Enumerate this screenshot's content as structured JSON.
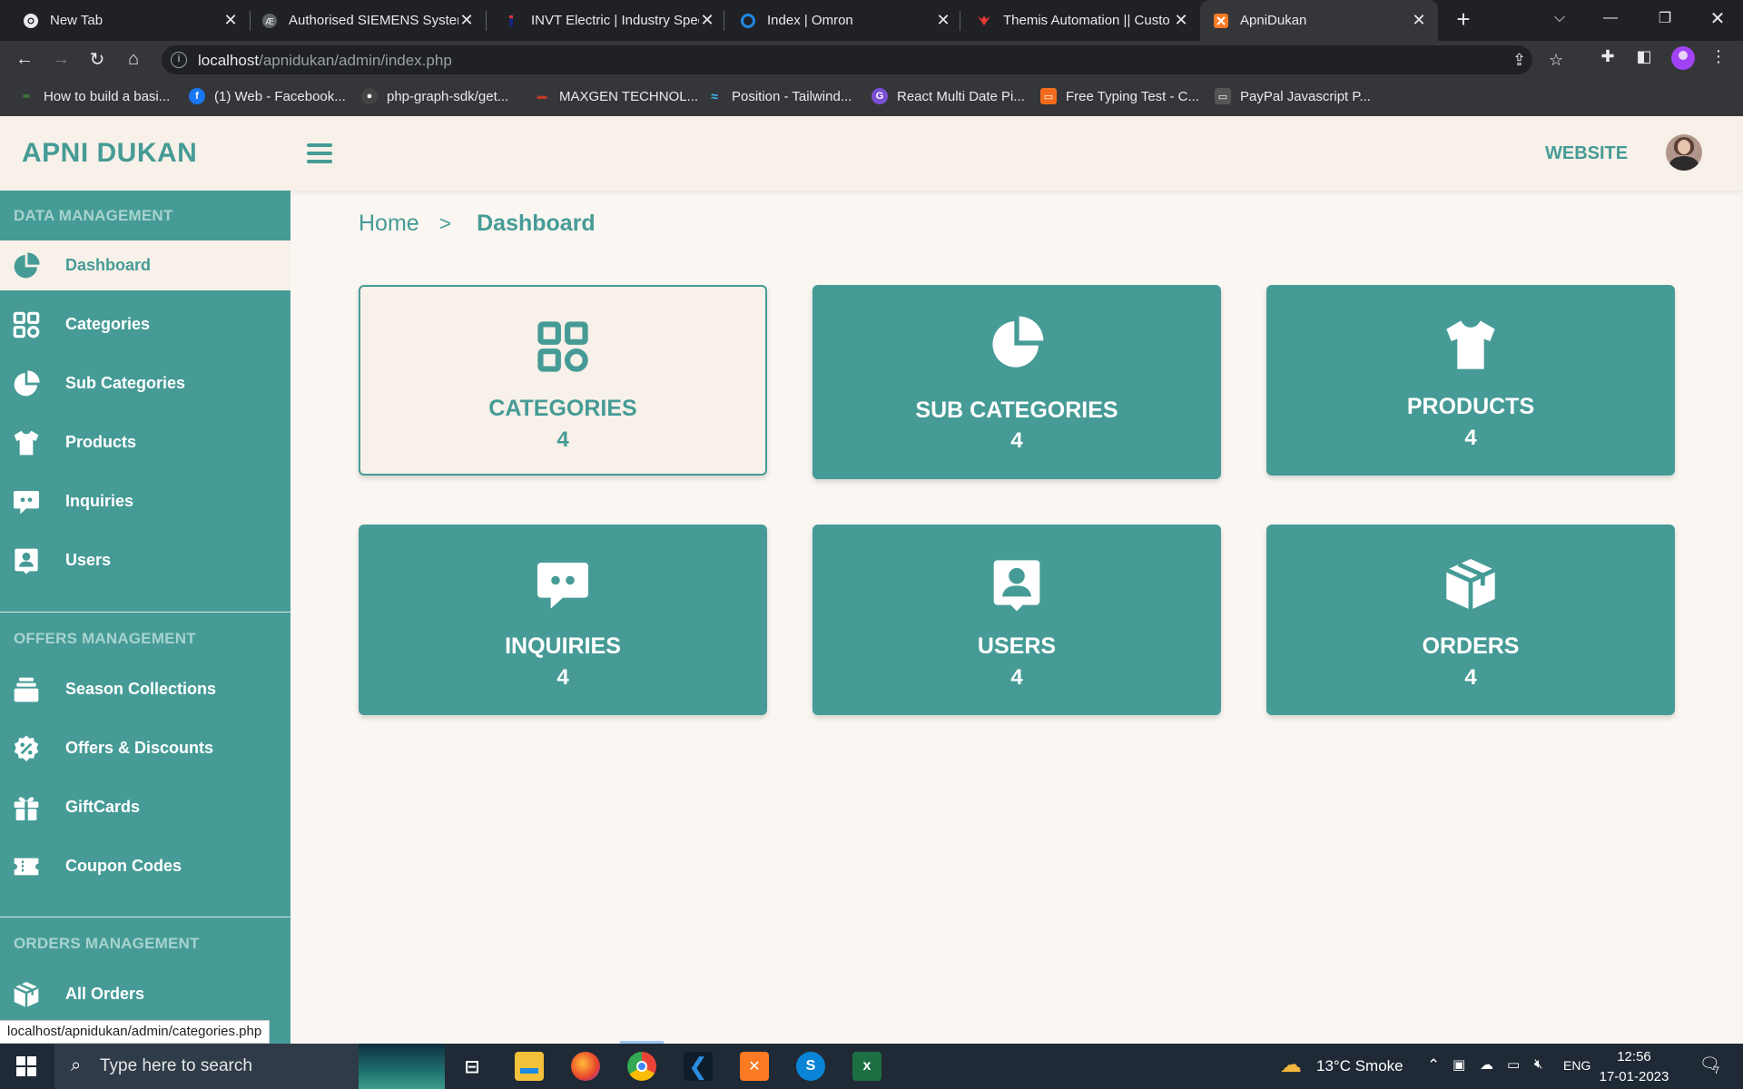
{
  "browser": {
    "tabs": [
      {
        "title": "New Tab",
        "favicon": "chrome-icon",
        "active": false
      },
      {
        "title": "Authorised SIEMENS Systen",
        "favicon": "siemens-icon",
        "active": false
      },
      {
        "title": "INVT Electric | Industry Spec",
        "favicon": "invt-icon",
        "active": false
      },
      {
        "title": "Index | Omron",
        "favicon": "omron-icon",
        "active": false
      },
      {
        "title": "Themis Automation || Custo",
        "favicon": "themis-icon",
        "active": false
      },
      {
        "title": "ApniDukan",
        "favicon": "xampp-icon",
        "active": true
      }
    ],
    "url_host": "localhost",
    "url_path": "/apnidukan/admin/index.php",
    "bookmarks": [
      {
        "label": "How to build a basi...",
        "icon": "bookmark-green-icon",
        "color": "#3c9c3c"
      },
      {
        "label": "(1) Web - Facebook...",
        "icon": "facebook-icon",
        "color": "#1877f2"
      },
      {
        "label": "php-graph-sdk/get...",
        "icon": "github-icon",
        "color": "#444444"
      },
      {
        "label": "MAXGEN TECHNOL...",
        "icon": "maxgen-icon",
        "color": "#c0392b"
      },
      {
        "label": "Position - Tailwind...",
        "icon": "tailwind-icon",
        "color": "#38bdf8"
      },
      {
        "label": "React Multi Date Pi...",
        "icon": "react-date-icon",
        "color": "#7b4fd3"
      },
      {
        "label": "Free Typing Test - C...",
        "icon": "typing-icon",
        "color": "#f26b1d"
      },
      {
        "label": "PayPal Javascript P...",
        "icon": "paypal-icon",
        "color": "#555555"
      }
    ],
    "status_url": "localhost/apnidukan/admin/categories.php"
  },
  "header": {
    "brand": "APNI DUKAN",
    "website_link": "WEBSITE"
  },
  "sidebar": {
    "sections": [
      {
        "title": "DATA MANAGEMENT"
      },
      {
        "title": "OFFERS MANAGEMENT"
      },
      {
        "title": "ORDERS MANAGEMENT"
      }
    ],
    "items": [
      {
        "label": "Dashboard",
        "icon": "pie-chart-icon",
        "active": true
      },
      {
        "label": "Categories",
        "icon": "grid-icon"
      },
      {
        "label": "Sub Categories",
        "icon": "pie-chart-icon"
      },
      {
        "label": "Products",
        "icon": "tshirt-icon"
      },
      {
        "label": "Inquiries",
        "icon": "chat-icon"
      },
      {
        "label": "Users",
        "icon": "user-badge-icon"
      },
      {
        "label": "Season Collections",
        "icon": "stack-icon"
      },
      {
        "label": "Offers & Discounts",
        "icon": "discount-icon"
      },
      {
        "label": "GiftCards",
        "icon": "gift-icon"
      },
      {
        "label": "Coupon Codes",
        "icon": "ticket-icon"
      },
      {
        "label": "All Orders",
        "icon": "box-icon"
      }
    ]
  },
  "breadcrumb": {
    "home": "Home",
    "separator": ">",
    "current": "Dashboard"
  },
  "cards": [
    {
      "title": "CATEGORIES",
      "count": "4",
      "icon": "grid-icon"
    },
    {
      "title": "SUB CATEGORIES",
      "count": "4",
      "icon": "pie-chart-icon"
    },
    {
      "title": "PRODUCTS",
      "count": "4",
      "icon": "tshirt-icon"
    },
    {
      "title": "INQUIRIES",
      "count": "4",
      "icon": "chat-icon"
    },
    {
      "title": "USERS",
      "count": "4",
      "icon": "user-badge-icon"
    },
    {
      "title": "ORDERS",
      "count": "4",
      "icon": "box-icon"
    }
  ],
  "taskbar": {
    "search_placeholder": "Type here to search",
    "weather": "13°C  Smoke",
    "language": "ENG",
    "time": "12:56",
    "date": "17-01-2023",
    "notification_count": "7"
  },
  "colors": {
    "accent": "#469b96",
    "cream": "#f8f1e9",
    "background": "#faf6f1"
  }
}
